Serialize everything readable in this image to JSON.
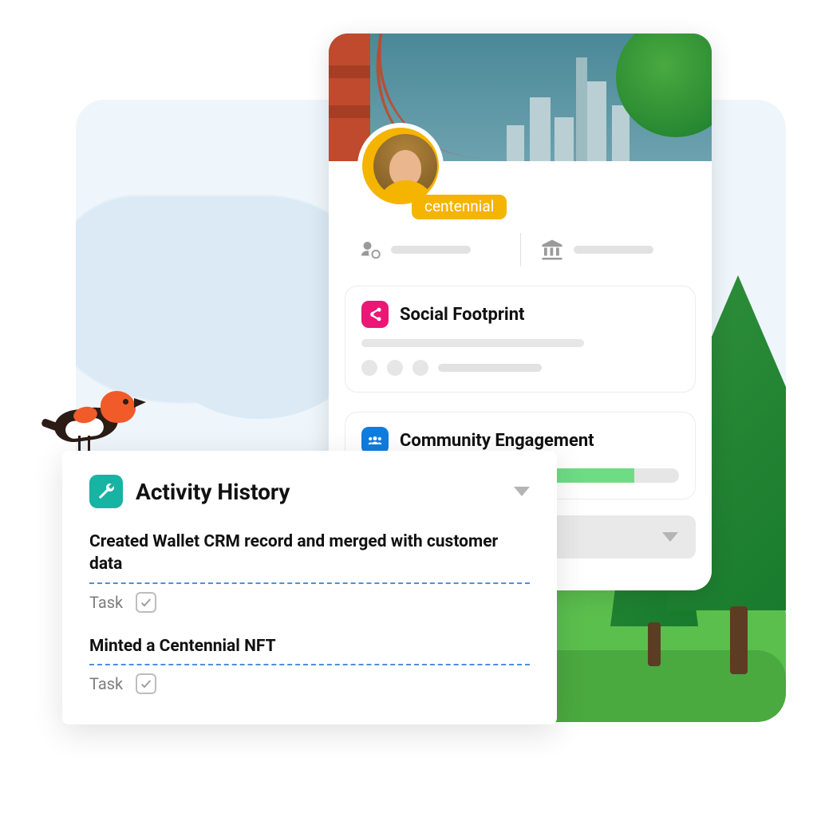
{
  "profile": {
    "badge": "centennial"
  },
  "panels": {
    "social": {
      "title": "Social Footprint"
    },
    "community": {
      "title": "Community Engagement",
      "progress_pct": 86
    }
  },
  "history": {
    "title": "Activity History",
    "items": [
      {
        "title": "Created Wallet CRM record and merged with customer data",
        "type": "Task",
        "done": true
      },
      {
        "title": "Minted a Centennial NFT",
        "type": "Task",
        "done": true
      }
    ]
  },
  "colors": {
    "accent_orange": "#f4b400",
    "accent_pink": "#eb1676",
    "accent_blue": "#0f7de0",
    "accent_teal": "#17b3a3",
    "progress_green": "#6edc85"
  }
}
